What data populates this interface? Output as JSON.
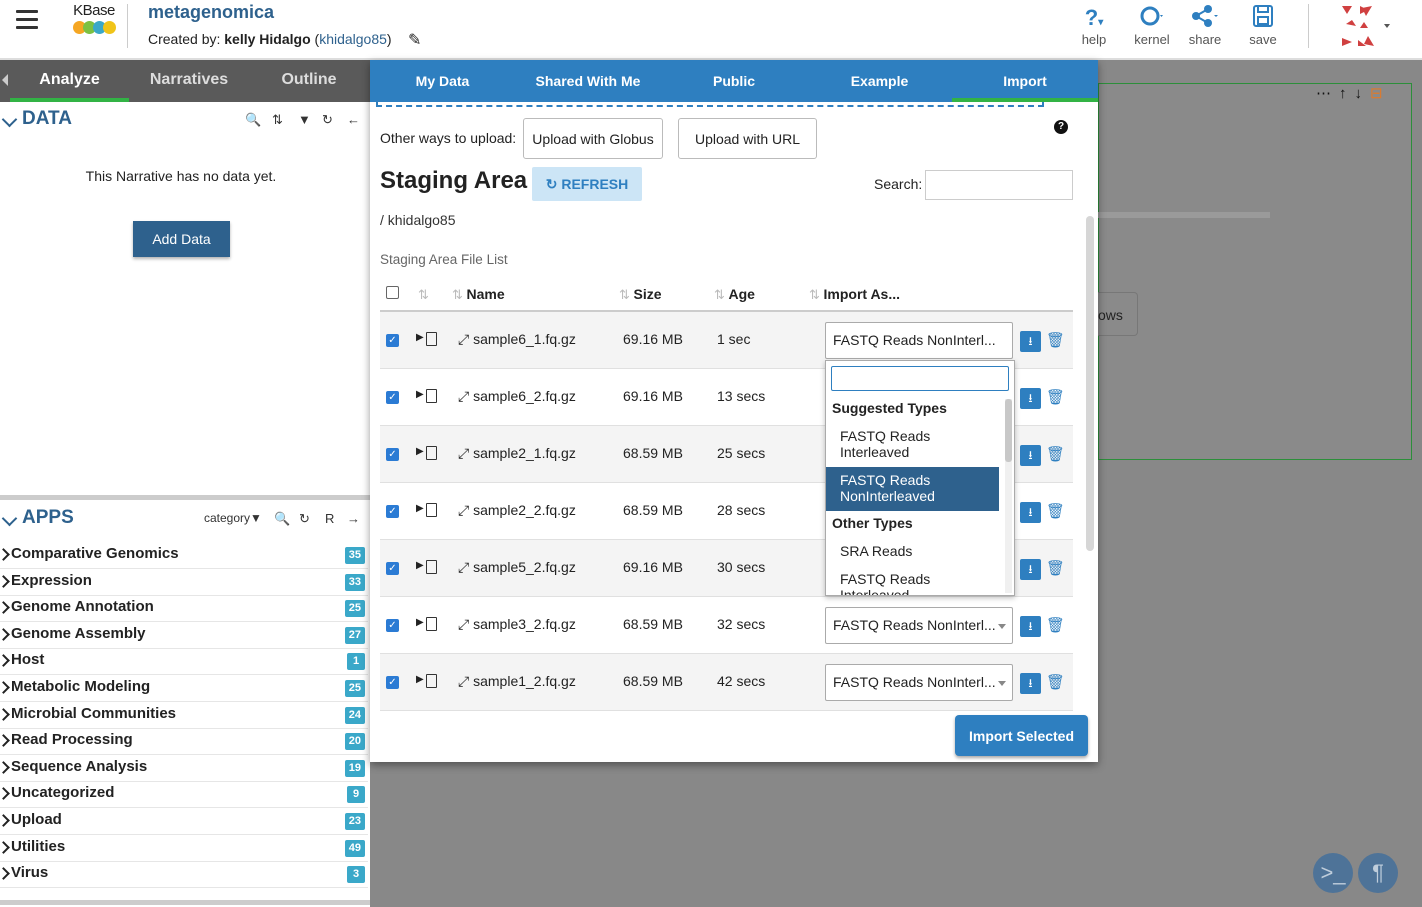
{
  "header": {
    "logo_text": "KBase",
    "narrative_title": "metagenomica",
    "created_by_label": "Created by:",
    "owner_name": "kelly Hidalgo",
    "owner_user": "khidalgo85",
    "toolbar": [
      {
        "label": "help",
        "icon": "help-icon"
      },
      {
        "label": "kernel",
        "icon": "kernel-icon"
      },
      {
        "label": "share",
        "icon": "share-icon"
      },
      {
        "label": "save",
        "icon": "save-icon"
      }
    ]
  },
  "left_panel": {
    "tabs": [
      "Analyze",
      "Narratives",
      "Outline"
    ],
    "active_tab": "Analyze",
    "data_section": {
      "title": "DATA",
      "empty_message": "This Narrative has no data yet.",
      "add_button": "Add Data"
    },
    "apps_section": {
      "title": "APPS",
      "category_label": "category",
      "r_label": "R",
      "categories": [
        {
          "label": "Comparative Genomics",
          "count": "35"
        },
        {
          "label": "Expression",
          "count": "33"
        },
        {
          "label": "Genome Annotation",
          "count": "25"
        },
        {
          "label": "Genome Assembly",
          "count": "27"
        },
        {
          "label": "Host",
          "count": "1"
        },
        {
          "label": "Metabolic Modeling",
          "count": "25"
        },
        {
          "label": "Microbial Communities",
          "count": "24"
        },
        {
          "label": "Read Processing",
          "count": "20"
        },
        {
          "label": "Sequence Analysis",
          "count": "19"
        },
        {
          "label": "Uncategorized",
          "count": "9"
        },
        {
          "label": "Upload",
          "count": "23"
        },
        {
          "label": "Utilities",
          "count": "49"
        },
        {
          "label": "Virus",
          "count": "3"
        }
      ]
    }
  },
  "modal": {
    "tabs": [
      "My Data",
      "Shared With Me",
      "Public",
      "Example",
      "Import"
    ],
    "active_tab": "Import",
    "other_ways_label": "Other ways to upload:",
    "globus_button": "Upload with Globus",
    "url_button": "Upload with URL",
    "help_glyph": "?",
    "staging_title": "Staging Area",
    "refresh_label": "REFRESH",
    "search_label": "Search:",
    "search_value": "",
    "path": "/ khidalgo85",
    "list_label": "Staging Area File List",
    "columns": [
      "Name",
      "Size",
      "Age",
      "Import As..."
    ],
    "files": [
      {
        "name": "sample6_1.fq.gz",
        "size": "69.16 MB",
        "age": "1 sec",
        "import_as": "FASTQ Reads NonInterl...",
        "checked": true
      },
      {
        "name": "sample6_2.fq.gz",
        "size": "69.16 MB",
        "age": "13 secs",
        "import_as": "",
        "checked": true
      },
      {
        "name": "sample2_1.fq.gz",
        "size": "68.59 MB",
        "age": "25 secs",
        "import_as": "",
        "checked": true
      },
      {
        "name": "sample2_2.fq.gz",
        "size": "68.59 MB",
        "age": "28 secs",
        "import_as": "",
        "checked": true
      },
      {
        "name": "sample5_2.fq.gz",
        "size": "69.16 MB",
        "age": "30 secs",
        "import_as": "",
        "checked": true
      },
      {
        "name": "sample3_2.fq.gz",
        "size": "68.59 MB",
        "age": "32 secs",
        "import_as": "FASTQ Reads NonInterl...",
        "checked": true
      },
      {
        "name": "sample1_2.fq.gz",
        "size": "68.59 MB",
        "age": "42 secs",
        "import_as": "FASTQ Reads NonInterl...",
        "checked": true
      }
    ],
    "dropdown": {
      "search_value": "",
      "group1": "Suggested Types",
      "group1_options": [
        "FASTQ Reads Interleaved",
        "FASTQ Reads NonInterleaved"
      ],
      "highlighted": "FASTQ Reads NonInterleaved",
      "group2": "Other Types",
      "group2_options": [
        "SRA Reads",
        "FASTQ Reads Interleaved"
      ]
    },
    "import_button": "Import Selected"
  },
  "background": {
    "rows_button_text": "ows"
  },
  "colors": {
    "brand_blue": "#2e618d",
    "tab_blue": "#2e7fc0",
    "active_green": "#32b345",
    "badge": "#3aa8c9"
  }
}
